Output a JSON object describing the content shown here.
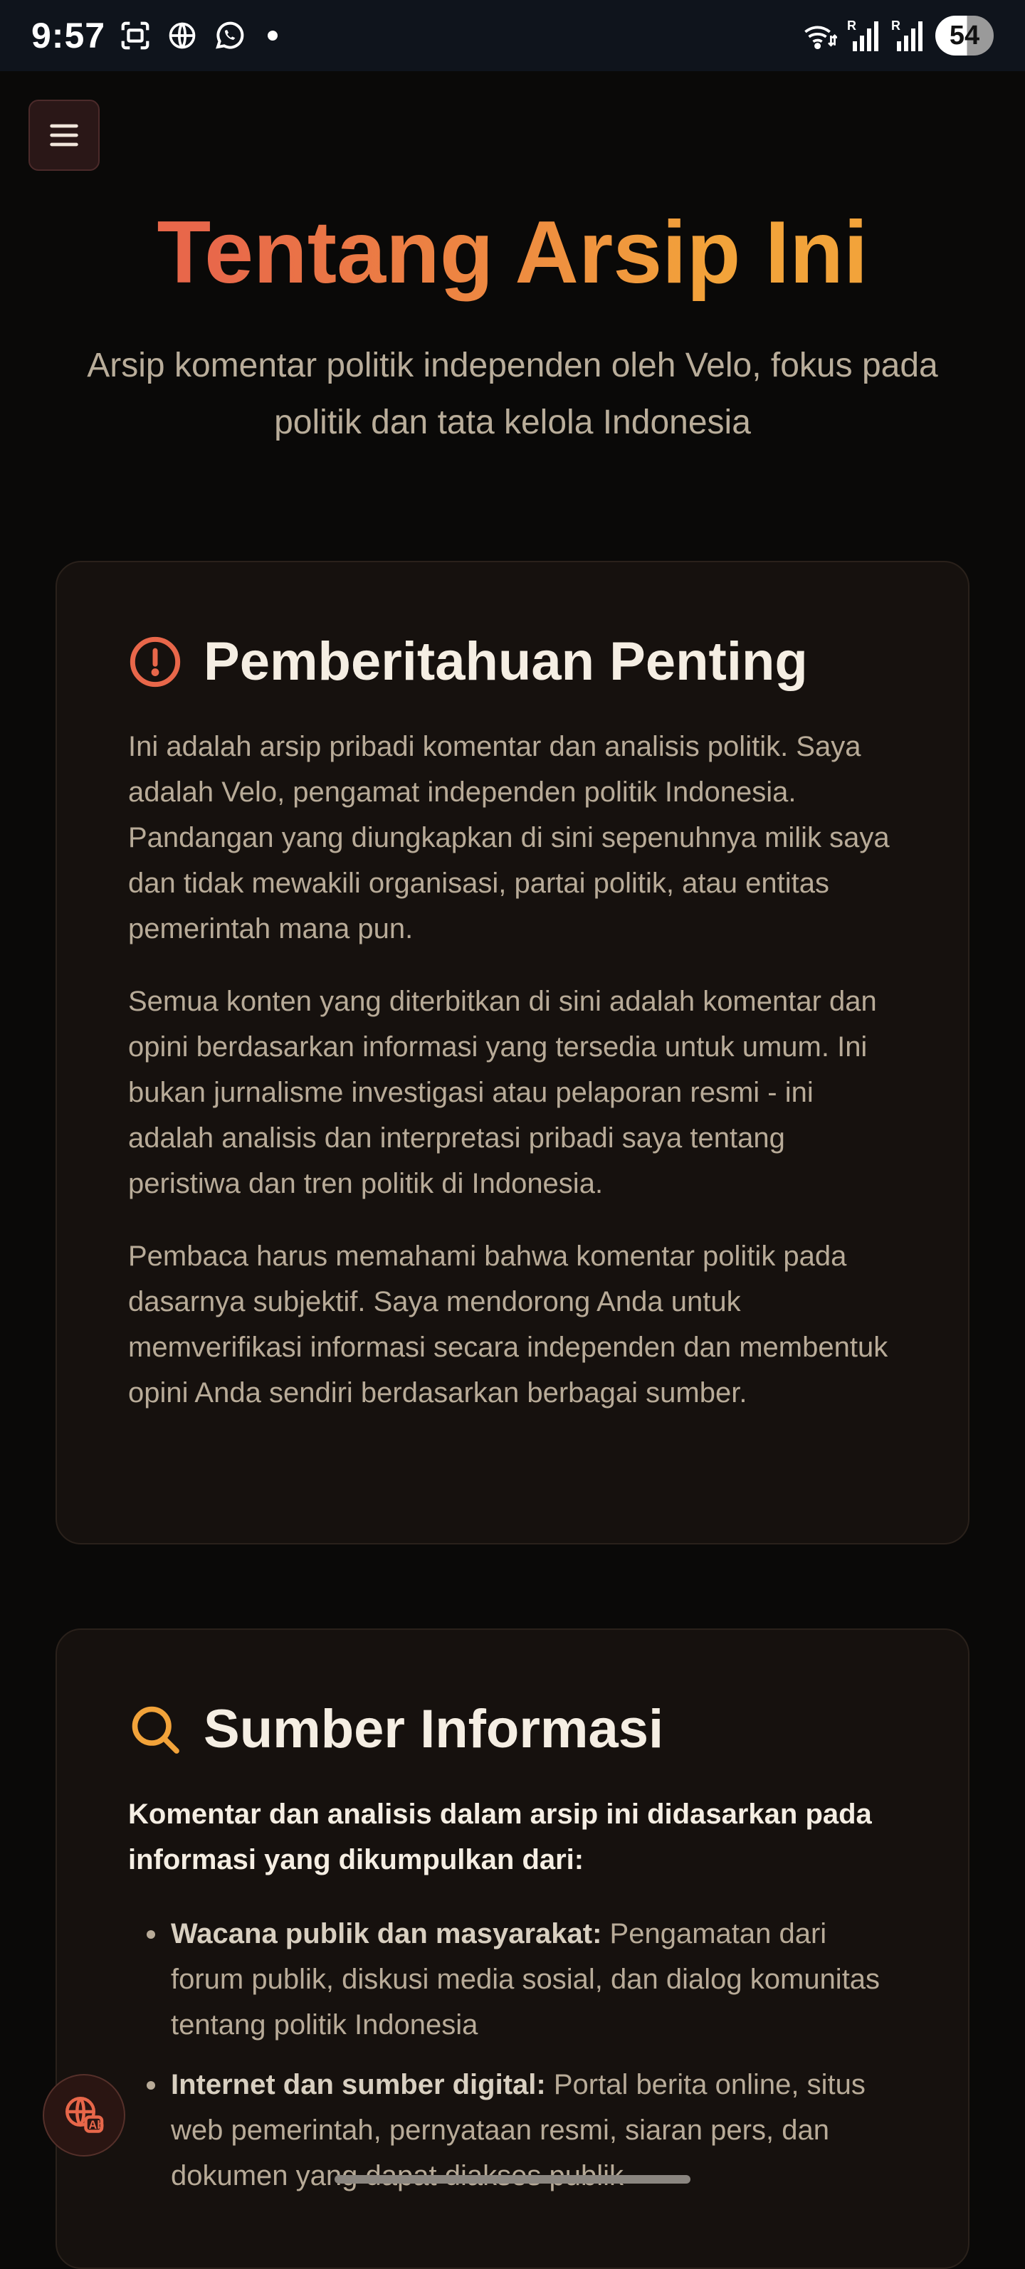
{
  "status_bar": {
    "time": "9:57",
    "battery": "54",
    "icons": [
      "screenshot-icon",
      "globe-icon",
      "whatsapp-icon",
      "notification-dot",
      "wifi-icon",
      "signal-icon",
      "signal-icon"
    ]
  },
  "nav": {
    "menu_icon": "hamburger-menu-icon"
  },
  "hero": {
    "title": "Tentang Arsip Ini",
    "subtitle": "Arsip komentar politik independen oleh Velo, fokus pada politik dan tata kelola Indonesia"
  },
  "notice": {
    "icon": "alert-circle-icon",
    "title": "Pemberitahuan Penting",
    "paragraphs": [
      "Ini adalah arsip pribadi komentar dan analisis politik. Saya adalah Velo, pengamat independen politik Indonesia. Pandangan yang diungkapkan di sini sepenuhnya milik saya dan tidak mewakili organisasi, partai politik, atau entitas pemerintah mana pun.",
      "Semua konten yang diterbitkan di sini adalah komentar dan opini berdasarkan informasi yang tersedia untuk umum. Ini bukan jurnalisme investigasi atau pelaporan resmi - ini adalah analisis dan interpretasi pribadi saya tentang peristiwa dan tren politik di Indonesia.",
      "Pembaca harus memahami bahwa komentar politik pada dasarnya subjektif. Saya mendorong Anda untuk memverifikasi informasi secara independen dan membentuk opini Anda sendiri berdasarkan berbagai sumber."
    ]
  },
  "sources": {
    "icon": "search-icon",
    "title": "Sumber Informasi",
    "lead": "Komentar dan analisis dalam arsip ini didasarkan pada informasi yang dikumpulkan dari:",
    "items": [
      {
        "label": "Wacana publik dan masyarakat:",
        "text": " Pengamatan dari forum publik, diskusi media sosial, dan dialog komunitas tentang politik Indonesia"
      },
      {
        "label": "Internet dan sumber digital:",
        "text": " Portal berita online, situs web pemerintah, pernyataan resmi, siaran pers, dan dokumen yang dapat diakses publik"
      }
    ]
  },
  "fab": {
    "icon": "language-globe-icon"
  },
  "colors": {
    "accent_start": "#e8674a",
    "accent_end": "#f2a33a",
    "background": "#0a0908",
    "card": "#16110e"
  }
}
